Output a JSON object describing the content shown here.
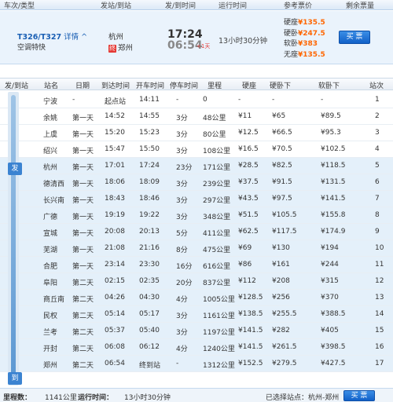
{
  "header": {
    "col_train": "车次/类型",
    "col_station": "发站/到站",
    "col_time": "发/到时间",
    "col_duration": "运行时间",
    "col_price": "参考票价",
    "col_left": "剩余票量"
  },
  "train": {
    "code": "T326/T327",
    "details_label": "详情",
    "type": "空调特快",
    "from": "杭州",
    "to": "郑州",
    "to_badge": "终",
    "dep_time": "17:24",
    "arr_time": "06:54",
    "arr_plus": "+1天",
    "duration": "13小时30分钟",
    "prices": [
      {
        "label": "硬座",
        "value": "¥135.5"
      },
      {
        "label": "硬卧",
        "value": "¥247.5"
      },
      {
        "label": "软卧",
        "value": "¥383"
      },
      {
        "label": "无座",
        "value": "¥135.5"
      }
    ],
    "buy_label": "买 票"
  },
  "table_header": {
    "fa_dao": "发/到站",
    "station": "站名",
    "day": "日期",
    "arr": "到达时间",
    "dep": "开车时间",
    "stop": "停车时间",
    "mileage": "里程",
    "hard_seat": "硬座",
    "hard_sleeper": "硬卧下",
    "soft_sleeper": "软卧下",
    "no": "站次"
  },
  "stops": [
    {
      "station": "宁波",
      "day": "-",
      "arr": "起点站",
      "dep": "14:11",
      "stop": "-",
      "mileage": "0",
      "hs": "-",
      "hsl": "-",
      "ssl": "-",
      "no": "1"
    },
    {
      "station": "余姚",
      "day": "第一天",
      "arr": "14:52",
      "dep": "14:55",
      "stop": "3分",
      "mileage": "48公里",
      "hs": "¥11",
      "hsl": "¥65",
      "ssl": "¥89.5",
      "no": "2"
    },
    {
      "station": "上虞",
      "day": "第一天",
      "arr": "15:20",
      "dep": "15:23",
      "stop": "3分",
      "mileage": "80公里",
      "hs": "¥12.5",
      "hsl": "¥66.5",
      "ssl": "¥95.3",
      "no": "3"
    },
    {
      "station": "绍兴",
      "day": "第一天",
      "arr": "15:47",
      "dep": "15:50",
      "stop": "3分",
      "mileage": "108公里",
      "hs": "¥16.5",
      "hsl": "¥70.5",
      "ssl": "¥102.5",
      "no": "4"
    },
    {
      "station": "杭州",
      "day": "第一天",
      "arr": "17:01",
      "dep": "17:24",
      "stop": "23分",
      "mileage": "171公里",
      "hs": "¥28.5",
      "hsl": "¥82.5",
      "ssl": "¥118.5",
      "no": "5"
    },
    {
      "station": "德清西",
      "day": "第一天",
      "arr": "18:06",
      "dep": "18:09",
      "stop": "3分",
      "mileage": "239公里",
      "hs": "¥37.5",
      "hsl": "¥91.5",
      "ssl": "¥131.5",
      "no": "6"
    },
    {
      "station": "长兴南",
      "day": "第一天",
      "arr": "18:43",
      "dep": "18:46",
      "stop": "3分",
      "mileage": "297公里",
      "hs": "¥43.5",
      "hsl": "¥97.5",
      "ssl": "¥141.5",
      "no": "7"
    },
    {
      "station": "广德",
      "day": "第一天",
      "arr": "19:19",
      "dep": "19:22",
      "stop": "3分",
      "mileage": "348公里",
      "hs": "¥51.5",
      "hsl": "¥105.5",
      "ssl": "¥155.8",
      "no": "8"
    },
    {
      "station": "宣城",
      "day": "第一天",
      "arr": "20:08",
      "dep": "20:13",
      "stop": "5分",
      "mileage": "411公里",
      "hs": "¥62.5",
      "hsl": "¥117.5",
      "ssl": "¥174.9",
      "no": "9"
    },
    {
      "station": "芜湖",
      "day": "第一天",
      "arr": "21:08",
      "dep": "21:16",
      "stop": "8分",
      "mileage": "475公里",
      "hs": "¥69",
      "hsl": "¥130",
      "ssl": "¥194",
      "no": "10"
    },
    {
      "station": "合肥",
      "day": "第一天",
      "arr": "23:14",
      "dep": "23:30",
      "stop": "16分",
      "mileage": "616公里",
      "hs": "¥86",
      "hsl": "¥161",
      "ssl": "¥244",
      "no": "11"
    },
    {
      "station": "阜阳",
      "day": "第二天",
      "arr": "02:15",
      "dep": "02:35",
      "stop": "20分",
      "mileage": "837公里",
      "hs": "¥112",
      "hsl": "¥208",
      "ssl": "¥315",
      "no": "12"
    },
    {
      "station": "商丘南",
      "day": "第二天",
      "arr": "04:26",
      "dep": "04:30",
      "stop": "4分",
      "mileage": "1005公里",
      "hs": "¥128.5",
      "hsl": "¥256",
      "ssl": "¥370",
      "no": "13"
    },
    {
      "station": "民权",
      "day": "第二天",
      "arr": "05:14",
      "dep": "05:17",
      "stop": "3分",
      "mileage": "1161公里",
      "hs": "¥138.5",
      "hsl": "¥255.5",
      "ssl": "¥388.5",
      "no": "14"
    },
    {
      "station": "兰考",
      "day": "第二天",
      "arr": "05:37",
      "dep": "05:40",
      "stop": "3分",
      "mileage": "1197公里",
      "hs": "¥141.5",
      "hsl": "¥282",
      "ssl": "¥405",
      "no": "15"
    },
    {
      "station": "开封",
      "day": "第二天",
      "arr": "06:08",
      "dep": "06:12",
      "stop": "4分",
      "mileage": "1240公里",
      "hs": "¥141.5",
      "hsl": "¥261.5",
      "ssl": "¥398.5",
      "no": "16"
    },
    {
      "station": "郑州",
      "day": "第二天",
      "arr": "06:54",
      "dep": "终到站",
      "stop": "-",
      "mileage": "1312公里",
      "hs": "¥152.5",
      "hsl": "¥279.5",
      "ssl": "¥427.5",
      "no": "17"
    }
  ],
  "markers": {
    "depart": "发",
    "arrive": "到"
  },
  "footer": {
    "mileage_label": "里程数：",
    "mileage": "1141公里",
    "runtime_label": "运行时间：",
    "runtime": "13小时30分钟",
    "selected": "已选择站点：杭州-郑州",
    "buy_label": "买 票"
  }
}
